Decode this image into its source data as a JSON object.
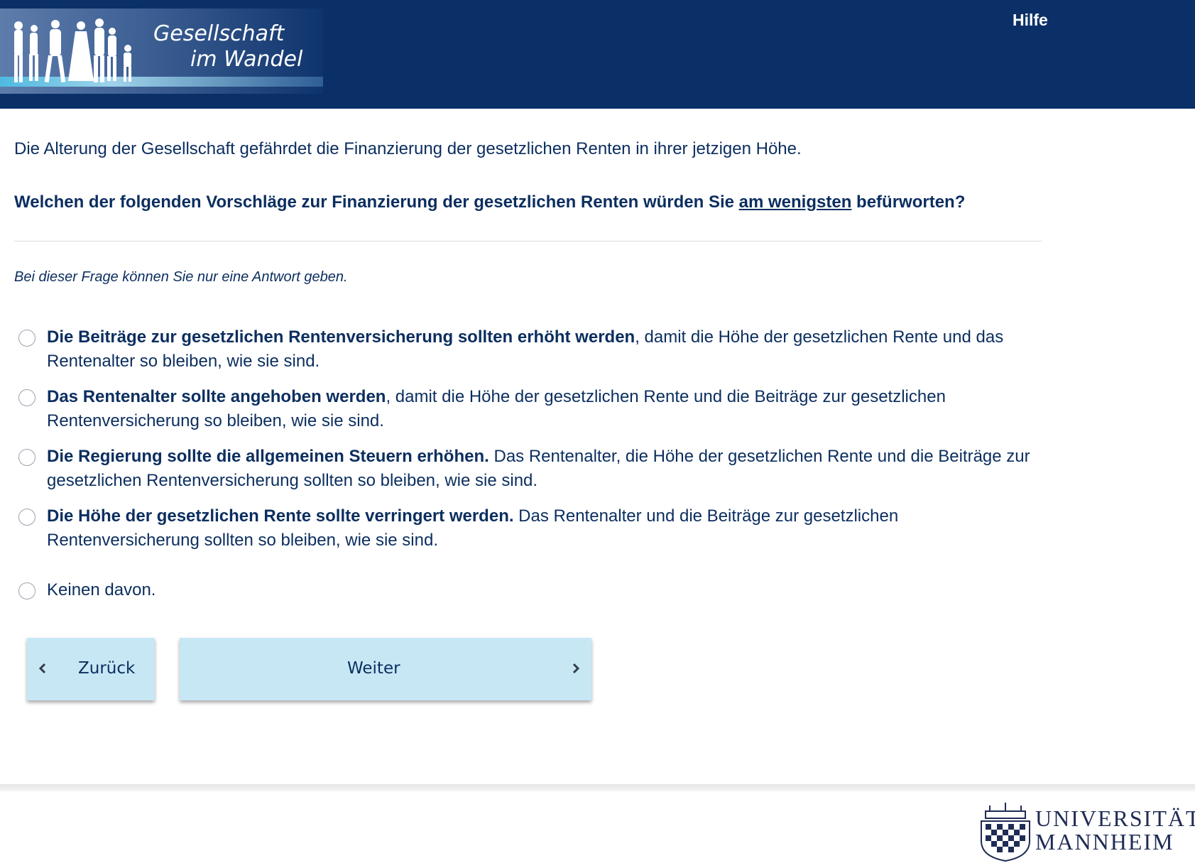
{
  "header": {
    "logo_line1": "Gesellschaft",
    "logo_line2": "im Wandel",
    "help_label": "Hilfe"
  },
  "colors": {
    "header_bg": "#0b3068",
    "text": "#0b2e5f",
    "button_bg": "#c7e7f5"
  },
  "survey": {
    "intro": "Die Alterung der Gesellschaft gefährdet die Finanzierung der gesetzlichen Renten in ihrer jetzigen Höhe.",
    "question_part1": "Welchen der folgenden Vorschläge zur Finanzierung der gesetzlichen Renten würden Sie ",
    "question_emphasis": "am wenigsten",
    "question_part2": " befürworten?",
    "hint": "Bei dieser Frage können Sie nur eine Antwort geben.",
    "options": [
      {
        "bold": "Die Beiträge zur gesetzlichen Rentenversicherung sollten erhöht werden",
        "rest": ", damit die Höhe der gesetzlichen Rente und das Rentenalter so bleiben, wie sie sind.",
        "selected": false
      },
      {
        "bold": "Das Rentenalter sollte angehoben werden",
        "rest": ", damit die Höhe der gesetzlichen Rente und die Beiträge zur gesetzlichen Rentenversicherung so bleiben, wie sie sind.",
        "selected": false
      },
      {
        "bold": "Die Regierung sollte die allgemeinen Steuern erhöhen.",
        "rest": " Das Rentenalter, die Höhe der gesetzlichen Rente und die Beiträge zur gesetzlichen Rentenversicherung sollten so bleiben, wie sie sind.",
        "selected": false
      },
      {
        "bold": "Die Höhe der gesetzlichen Rente sollte verringert werden.",
        "rest": " Das Rentenalter und die Beiträge zur gesetzlichen Rentenversicherung sollten so bleiben, wie sie sind.",
        "selected": false
      },
      {
        "bold": "",
        "rest": "Keinen davon.",
        "selected": false
      }
    ]
  },
  "nav": {
    "back_label": "Zurück",
    "next_label": "Weiter"
  },
  "footer": {
    "uni_line1": "UNIVERSITÄT",
    "uni_line2": "MANNHEIM"
  }
}
